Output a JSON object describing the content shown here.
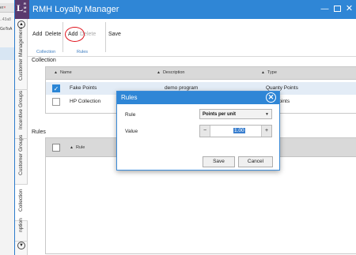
{
  "background_window": {
    "tab_fragment": "er",
    "tab_close": "×",
    "address_fragment": "..43a8",
    "link_fragment": "GoToA"
  },
  "window": {
    "logo_letter": "L",
    "logo_stack": [
      "R",
      "M",
      "H"
    ],
    "title": "RMH Loyalty Manager",
    "minimize_glyph": "—",
    "close_glyph": "✕"
  },
  "rail": {
    "scroll_up": "▲",
    "scroll_down": "▼",
    "tabs": [
      {
        "label": "Customer Management"
      },
      {
        "label": "Incentive Groups"
      },
      {
        "label": "Customer Groups"
      },
      {
        "label": "Collection"
      },
      {
        "label": "nption"
      }
    ]
  },
  "ribbon": {
    "collection_group": {
      "add": "Add",
      "delete": "Delete",
      "label": "Collection"
    },
    "rules_group": {
      "add": "Add",
      "delete": "Delete",
      "label": "Rules"
    },
    "save": "Save"
  },
  "collection": {
    "section_label": "Collection",
    "columns": [
      "Name",
      "Description",
      "Type"
    ],
    "sort_glyph": "▲",
    "rows": [
      {
        "checked": true,
        "name": "Fake Points",
        "description": "demo program",
        "type": "Quanty Points"
      },
      {
        "checked": false,
        "name": "HP Collection",
        "description": "",
        "type": "Points"
      }
    ]
  },
  "rules": {
    "section_label": "Rules",
    "columns": [
      "Rule"
    ]
  },
  "dialog": {
    "title": "Rules",
    "close_glyph": "✕",
    "rule_label": "Rule",
    "rule_value": "Points per unit",
    "value_label": "Value",
    "value": "1.00",
    "minus": "−",
    "plus": "+",
    "select_arrow": "▼",
    "save": "Save",
    "cancel": "Cancel"
  },
  "colors": {
    "accent": "#2f86d6",
    "annotation": "#e0141e"
  }
}
